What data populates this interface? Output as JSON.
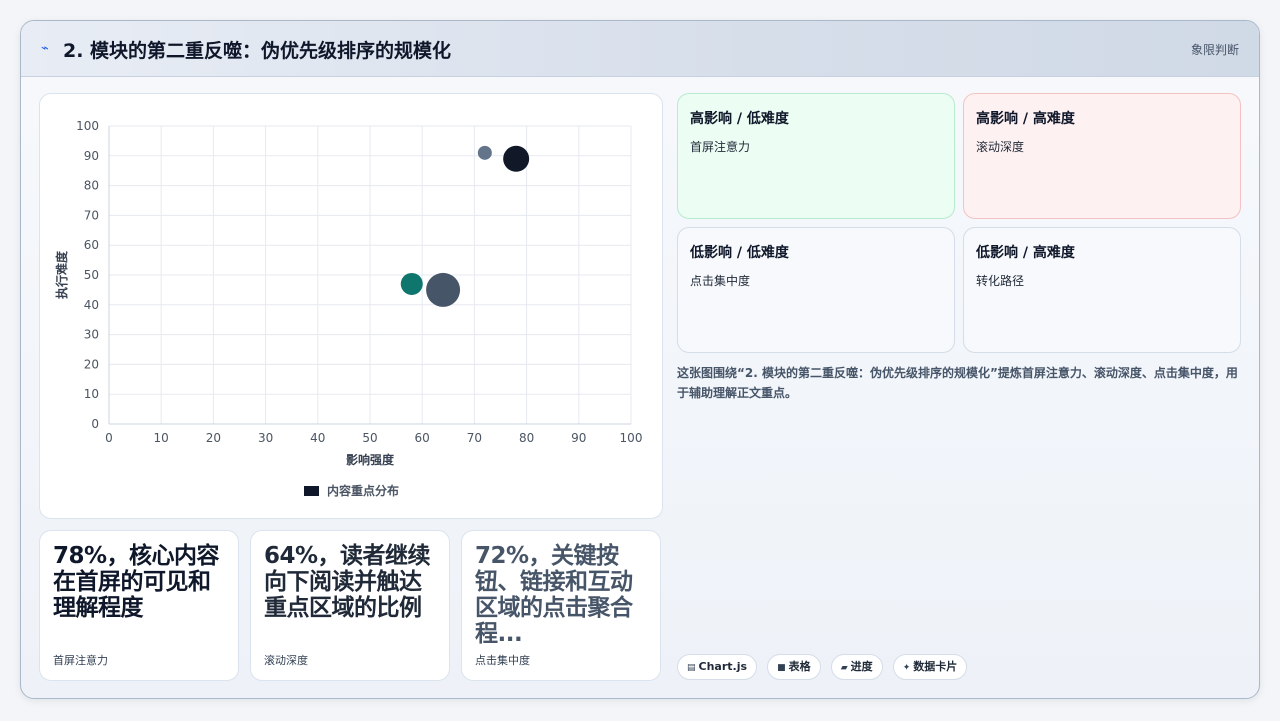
{
  "header": {
    "icon": "lightning-icon",
    "title": "2. 模块的第二重反噬：伪优先级排序的规模化",
    "tag": "象限判断"
  },
  "chart_data": {
    "type": "scatter",
    "subtype": "bubble",
    "xlabel": "影响强度",
    "ylabel": "执行难度",
    "xlim": [
      0,
      100
    ],
    "ylim": [
      0,
      100
    ],
    "xticks": [
      0,
      10,
      20,
      30,
      40,
      50,
      60,
      70,
      80,
      90,
      100
    ],
    "yticks": [
      0,
      10,
      20,
      30,
      40,
      50,
      60,
      70,
      80,
      90,
      100
    ],
    "grid": true,
    "legend_position": "bottom",
    "series": [
      {
        "name": "内容重点分布",
        "color": "#0f172a",
        "points": [
          {
            "x": 78,
            "y": 89,
            "r": 13,
            "color": "#111827"
          },
          {
            "x": 72,
            "y": 91,
            "r": 7,
            "color": "#64748b"
          },
          {
            "x": 58,
            "y": 47,
            "r": 11,
            "color": "#0f766e"
          },
          {
            "x": 64,
            "y": 45,
            "r": 17,
            "color": "#475569"
          }
        ]
      }
    ]
  },
  "quadrants": [
    {
      "title": "高影响 / 低难度",
      "item": "首屏注意力"
    },
    {
      "title": "高影响 / 高难度",
      "item": "滚动深度"
    },
    {
      "title": "低影响 / 低难度",
      "item": "点击集中度"
    },
    {
      "title": "低影响 / 高难度",
      "item": "转化路径"
    }
  ],
  "caption": "这张图围绕“2. 模块的第二重反噬：伪优先级排序的规模化”提炼首屏注意力、滚动深度、点击集中度，用于辅助理解正文重点。",
  "stats": [
    {
      "value": "78%，核心内容在首屏的可见和理解程度",
      "label": "首屏注意力"
    },
    {
      "value": "64%，读者继续向下阅读并触达重点区域的比例",
      "label": "滚动深度"
    },
    {
      "value": "72%，关键按钮、链接和互动区域的点击聚合程...",
      "label": "点击集中度"
    }
  ],
  "pills": [
    {
      "icon": "chart-icon",
      "label": "Chart.js"
    },
    {
      "icon": "table-icon",
      "label": "表格"
    },
    {
      "icon": "progress-icon",
      "label": "进度"
    },
    {
      "icon": "sparkle-icon",
      "label": "数据卡片"
    }
  ]
}
